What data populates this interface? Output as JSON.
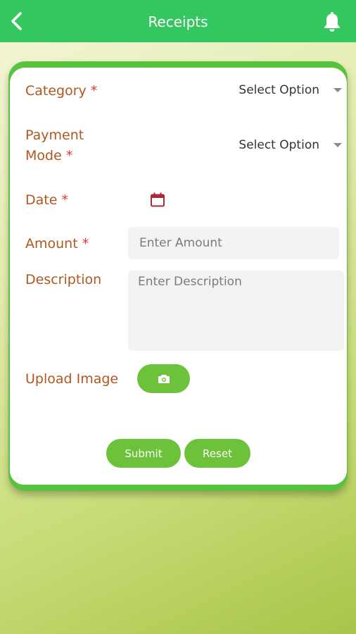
{
  "header": {
    "title": "Receipts",
    "back_icon": "chevron-left-icon",
    "bell_icon": "bell-icon"
  },
  "form": {
    "category": {
      "label": "Category",
      "required_mark": "*",
      "value": "Select Option"
    },
    "payment_mode": {
      "label_line1": "Payment",
      "label_line2": "Mode",
      "required_mark": "*",
      "value": "Select Option"
    },
    "date": {
      "label": "Date",
      "required_mark": "*",
      "icon": "calendar-icon"
    },
    "amount": {
      "label": "Amount",
      "required_mark": "*",
      "placeholder": "Enter Amount"
    },
    "description": {
      "label": "Description",
      "placeholder": "Enter Description"
    },
    "upload": {
      "label": "Upload Image",
      "icon": "camera-icon"
    }
  },
  "actions": {
    "submit_label": "Submit",
    "reset_label": "Reset"
  },
  "colors": {
    "header_bg": "#35c75f",
    "label": "#b0571f",
    "required": "#e03a2c",
    "button_bg": "#6cc23a",
    "calendar_icon": "#b0263a"
  }
}
